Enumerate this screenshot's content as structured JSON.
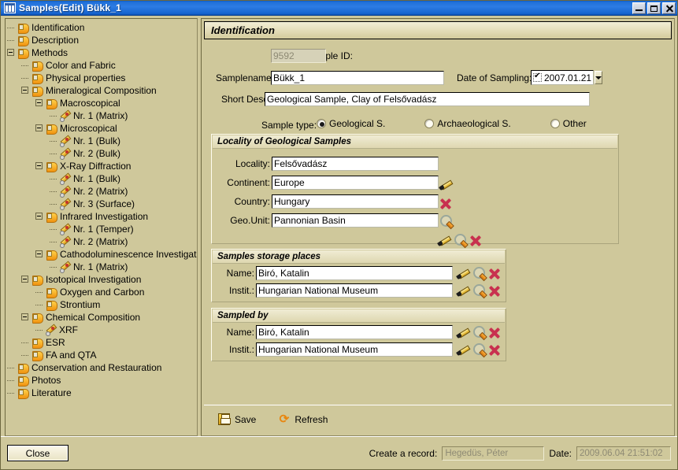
{
  "window": {
    "title": "Samples(Edit)  Bükk_1",
    "app_icon": "window-grid-icon",
    "minimize": "minimize-icon",
    "maximize": "maximize-icon",
    "close": "close-icon"
  },
  "tree": {
    "nodes": [
      {
        "label": "Identification",
        "depth": 1,
        "icon": "tag-icon",
        "expander": ""
      },
      {
        "label": "Description",
        "depth": 1,
        "icon": "tag-icon",
        "expander": ""
      },
      {
        "label": "Methods",
        "depth": 1,
        "icon": "tag-icon",
        "expander": "-"
      },
      {
        "label": "Color and Fabric",
        "depth": 2,
        "icon": "tag-icon",
        "expander": ""
      },
      {
        "label": "Physical properties",
        "depth": 2,
        "icon": "tag-icon",
        "expander": ""
      },
      {
        "label": "Mineralogical Composition",
        "depth": 2,
        "icon": "tag-icon",
        "expander": "-"
      },
      {
        "label": "Macroscopical",
        "depth": 3,
        "icon": "tag-icon",
        "expander": "-"
      },
      {
        "label": "Nr. 1 (Matrix)",
        "depth": 4,
        "icon": "pencil-icon",
        "expander": ""
      },
      {
        "label": "Microscopical",
        "depth": 3,
        "icon": "tag-icon",
        "expander": "-"
      },
      {
        "label": "Nr. 1 (Bulk)",
        "depth": 4,
        "icon": "pencil-icon",
        "expander": ""
      },
      {
        "label": "Nr. 2 (Bulk)",
        "depth": 4,
        "icon": "pencil-icon",
        "expander": ""
      },
      {
        "label": "X-Ray Diffraction",
        "depth": 3,
        "icon": "tag-icon",
        "expander": "-"
      },
      {
        "label": "Nr. 1 (Bulk)",
        "depth": 4,
        "icon": "pencil-icon",
        "expander": ""
      },
      {
        "label": "Nr. 2 (Matrix)",
        "depth": 4,
        "icon": "pencil-icon",
        "expander": ""
      },
      {
        "label": "Nr. 3 (Surface)",
        "depth": 4,
        "icon": "pencil-icon",
        "expander": ""
      },
      {
        "label": "Infrared Investigation",
        "depth": 3,
        "icon": "tag-icon",
        "expander": "-"
      },
      {
        "label": "Nr. 1 (Temper)",
        "depth": 4,
        "icon": "pencil-icon",
        "expander": ""
      },
      {
        "label": "Nr. 2 (Matrix)",
        "depth": 4,
        "icon": "pencil-icon",
        "expander": ""
      },
      {
        "label": "Cathodoluminescence Investigation",
        "depth": 3,
        "icon": "tag-icon",
        "expander": "-"
      },
      {
        "label": "Nr. 1 (Matrix)",
        "depth": 4,
        "icon": "pencil-icon",
        "expander": ""
      },
      {
        "label": "Isotopical Investigation",
        "depth": 2,
        "icon": "tag-icon",
        "expander": "-"
      },
      {
        "label": "Oxygen and Carbon",
        "depth": 3,
        "icon": "tag-icon",
        "expander": ""
      },
      {
        "label": "Strontium",
        "depth": 3,
        "icon": "tag-icon",
        "expander": ""
      },
      {
        "label": "Chemical Composition",
        "depth": 2,
        "icon": "tag-icon",
        "expander": "-"
      },
      {
        "label": "XRF",
        "depth": 3,
        "icon": "pencil-icon",
        "expander": ""
      },
      {
        "label": "ESR",
        "depth": 2,
        "icon": "tag-icon",
        "expander": ""
      },
      {
        "label": "FA and QTA",
        "depth": 2,
        "icon": "tag-icon",
        "expander": ""
      },
      {
        "label": "Conservation and Restauration",
        "depth": 1,
        "icon": "tag-icon",
        "expander": ""
      },
      {
        "label": "Photos",
        "depth": 1,
        "icon": "tag-icon",
        "expander": ""
      },
      {
        "label": "Literature",
        "depth": 1,
        "icon": "tag-icon",
        "expander": ""
      }
    ]
  },
  "identification": {
    "header": "Identification",
    "sample_id_label": "Sample ID:",
    "sample_id_value": "9592",
    "samplename_label": "Samplename:",
    "samplename_value": "Bükk_1",
    "date_label": "Date of Sampling:",
    "date_value": "2007.01.21",
    "short_desc_label": "Short Desc.:",
    "short_desc_value": "Geological Sample, Clay of Felsővadász",
    "sample_type_label": "Sample type:",
    "sample_types": [
      {
        "label": "Geological S.",
        "checked": true
      },
      {
        "label": "Archaeological S.",
        "checked": false
      },
      {
        "label": "Other",
        "checked": false
      }
    ]
  },
  "locality": {
    "title": "Locality of Geological Samples",
    "rows": [
      {
        "label": "Locality:",
        "value": "Felsővadász"
      },
      {
        "label": "Continent:",
        "value": "Europe"
      },
      {
        "label": "Country:",
        "value": "Hungary"
      },
      {
        "label": "Geo.Unit:",
        "value": "Pannonian Basin"
      }
    ]
  },
  "storage": {
    "title": "Samples storage places",
    "rows": [
      {
        "label": "Name:",
        "value": "Biró, Katalin"
      },
      {
        "label": "Instit.:",
        "value": "Hungarian National Museum"
      }
    ]
  },
  "sampled_by": {
    "title": "Sampled by",
    "rows": [
      {
        "label": "Name:",
        "value": "Biró, Katalin"
      },
      {
        "label": "Instit.:",
        "value": "Hungarian National Museum"
      }
    ]
  },
  "actions": {
    "save_label": "Save",
    "refresh_label": "Refresh",
    "save_icon": "save-disk-icon",
    "refresh_icon": "refresh-icon"
  },
  "footer": {
    "close_label": "Close",
    "create_record_label": "Create a record:",
    "create_record_value": "Hegedüs, Péter",
    "date_label": "Date:",
    "date_value": "2009.06.04 21:51:02"
  },
  "colors": {
    "background": "#cfc89b",
    "titlebar": "#2d7ce4",
    "field_bg": "#ffffff",
    "accent_orange": "#e8860f",
    "delete_red": "#c8314f"
  }
}
